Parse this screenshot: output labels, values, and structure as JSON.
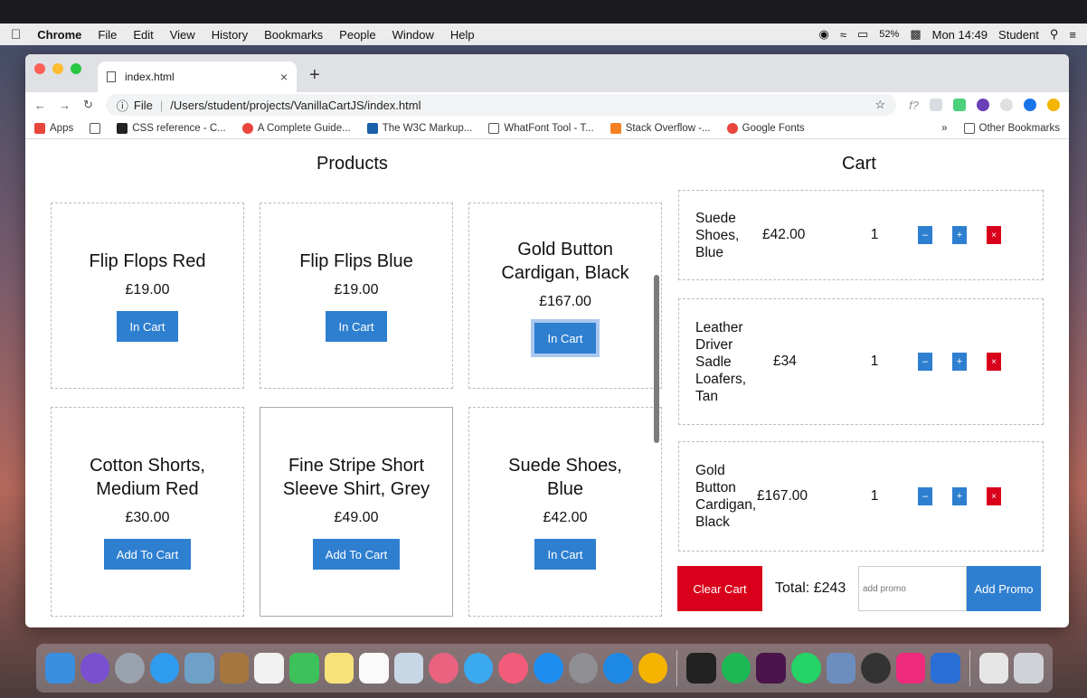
{
  "menubar": {
    "app": "Chrome",
    "items": [
      "File",
      "Edit",
      "View",
      "History",
      "Bookmarks",
      "People",
      "Window",
      "Help"
    ],
    "battery": "52%",
    "clock": "Mon 14:49",
    "user": "Student"
  },
  "browser": {
    "tab_title": "index.html",
    "url_scheme": "File",
    "url": "/Users/student/projects/VanillaCartJS/index.html",
    "bookmarks": [
      {
        "label": "Apps",
        "icon": "apps-icon",
        "color": "#e8453c"
      },
      {
        "label": "",
        "icon": "doc-icon",
        "color": "#ffffff"
      },
      {
        "label": "CSS reference - C...",
        "icon": "css-tricks-icon",
        "color": "#222222"
      },
      {
        "label": "A Complete Guide...",
        "icon": "css-tricks-star-icon",
        "color": "#e8453c"
      },
      {
        "label": "The W3C Markup...",
        "icon": "w3c-icon",
        "color": "#1a5faa"
      },
      {
        "label": "WhatFont Tool - T...",
        "icon": "doc-icon",
        "color": "#ffffff"
      },
      {
        "label": "Stack Overflow -...",
        "icon": "stackoverflow-icon",
        "color": "#f48024"
      },
      {
        "label": "Google Fonts",
        "icon": "google-fonts-icon",
        "color": "#e8453c"
      }
    ],
    "other_bookmarks": "Other Bookmarks",
    "more": "»"
  },
  "products_heading": "Products",
  "cart_heading": "Cart",
  "products": [
    {
      "name": "Flip Flops Red",
      "price": "£19.00",
      "button": "In Cart"
    },
    {
      "name": "Flip Flips Blue",
      "price": "£19.00",
      "button": "In Cart"
    },
    {
      "name": "Gold Button Cardigan, Black",
      "price": "£167.00",
      "button": "In Cart"
    },
    {
      "name": "Cotton Shorts, Medium Red",
      "price": "£30.00",
      "button": "Add To Cart"
    },
    {
      "name": "Fine Stripe Short Sleeve Shirt, Grey",
      "price": "£49.00",
      "button": "Add To Cart"
    },
    {
      "name": "Suede Shoes, Blue",
      "price": "£42.00",
      "button": "In Cart"
    }
  ],
  "cart": {
    "items": [
      {
        "name": "Suede Shoes, Blue",
        "price": "£42.00",
        "qty": "1"
      },
      {
        "name": "Leather Driver Sadle Loafers, Tan",
        "price": "£34",
        "qty": "1"
      },
      {
        "name": "Gold Button Cardigan, Black",
        "price": "£167.00",
        "qty": "1"
      }
    ],
    "minus": "–",
    "plus": "+",
    "remove": "×",
    "clear_label": "Clear Cart",
    "total": "Total: £243",
    "promo_placeholder": "add promo",
    "promo_button": "Add Promo"
  },
  "colors": {
    "accent": "#2e7fd0",
    "danger": "#d9001b"
  }
}
